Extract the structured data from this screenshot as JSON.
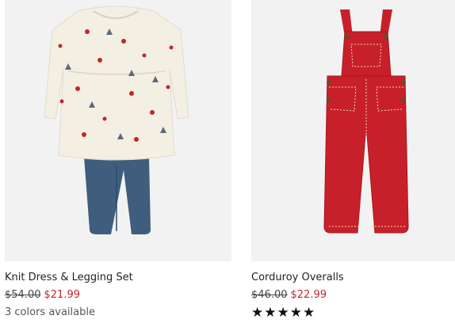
{
  "products": [
    {
      "title": "Knit Dress & Legging Set",
      "original_price": "$54.00",
      "sale_price": "$21.99",
      "colors_available": "3 colors available",
      "image_icon": "dress-legging-set-image"
    },
    {
      "title": "Corduroy Overalls",
      "original_price": "$46.00",
      "sale_price": "$22.99",
      "rating": 5,
      "rating_max": 5,
      "rating_stars": "★★★★★",
      "image_icon": "corduroy-overalls-image"
    }
  ],
  "colors": {
    "sale_price": "#c1272d",
    "image_background": "#f2f2f2",
    "dress": "#f4efe3",
    "legging": "#3f5e7e",
    "overalls": "#c8202a"
  }
}
